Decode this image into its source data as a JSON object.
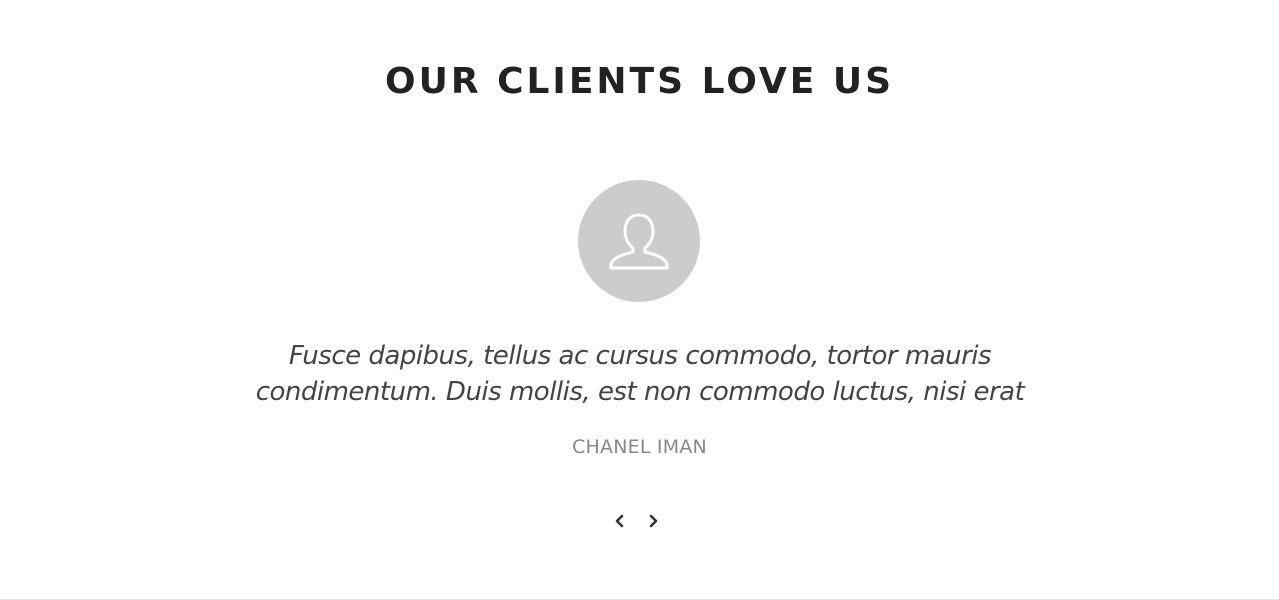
{
  "section": {
    "title": "OUR CLIENTS LOVE US"
  },
  "testimonial": {
    "avatar_icon": "user-outline-icon",
    "quote_line1": "Fusce dapibus, tellus ac cursus commodo, tortor mauris",
    "quote_line2": "condimentum. Duis mollis, est non commodo luctus, nisi erat",
    "author": "CHANEL IMAN"
  },
  "navigation": {
    "prev_icon": "chevron-left-icon",
    "next_icon": "chevron-right-icon"
  },
  "colors": {
    "title": "#222222",
    "avatar_bg": "#cccccc",
    "quote": "#444444",
    "author": "#888888"
  }
}
